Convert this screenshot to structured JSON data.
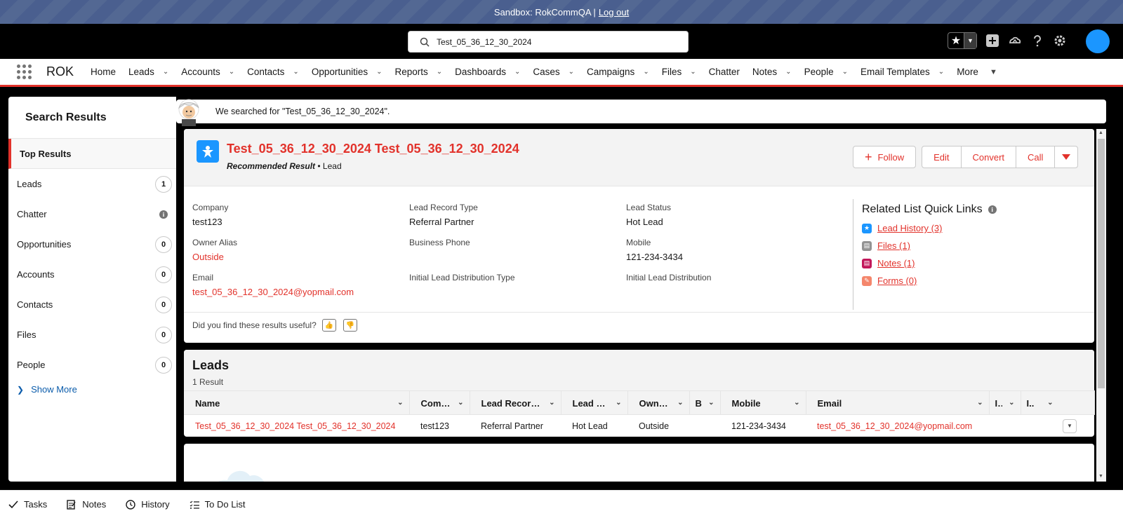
{
  "banner": {
    "text": "Sandbox: RokCommQA |",
    "logout": "Log out"
  },
  "search": {
    "value": "Test_05_36_12_30_2024"
  },
  "app": {
    "name": "ROK",
    "nav": [
      {
        "label": "Home",
        "chevron": false
      },
      {
        "label": "Leads",
        "chevron": true
      },
      {
        "label": "Accounts",
        "chevron": true
      },
      {
        "label": "Contacts",
        "chevron": true
      },
      {
        "label": "Opportunities",
        "chevron": true
      },
      {
        "label": "Reports",
        "chevron": true
      },
      {
        "label": "Dashboards",
        "chevron": true
      },
      {
        "label": "Cases",
        "chevron": true
      },
      {
        "label": "Campaigns",
        "chevron": true
      },
      {
        "label": "Files",
        "chevron": true
      },
      {
        "label": "Chatter",
        "chevron": false
      },
      {
        "label": "Notes",
        "chevron": true
      },
      {
        "label": "People",
        "chevron": true
      },
      {
        "label": "Email Templates",
        "chevron": true
      },
      {
        "label": "More",
        "chevron": true
      }
    ]
  },
  "sidebar": {
    "title": "Search Results",
    "top": "Top Results",
    "items": [
      {
        "label": "Leads",
        "count": "1"
      },
      {
        "label": "Chatter",
        "count": ""
      },
      {
        "label": "Opportunities",
        "count": "0"
      },
      {
        "label": "Accounts",
        "count": "0"
      },
      {
        "label": "Contacts",
        "count": "0"
      },
      {
        "label": "Files",
        "count": "0"
      },
      {
        "label": "People",
        "count": "0"
      }
    ],
    "show_more": "Show More"
  },
  "notice": "We searched for \"Test_05_36_12_30_2024\".",
  "recommended": {
    "title": "Test_05_36_12_30_2024 Test_05_36_12_30_2024",
    "badge": "Recommended Result",
    "separator": "•",
    "type": "Lead",
    "actions": {
      "follow": "Follow",
      "edit": "Edit",
      "convert": "Convert",
      "call": "Call"
    },
    "fields": [
      {
        "label": "Company",
        "value": "test123",
        "link": false
      },
      {
        "label": "Lead Record Type",
        "value": "Referral Partner",
        "link": false
      },
      {
        "label": "Lead Status",
        "value": "Hot Lead",
        "link": false
      },
      {
        "label": "Owner Alias",
        "value": "Outside",
        "link": true
      },
      {
        "label": "Business Phone",
        "value": "",
        "link": false
      },
      {
        "label": "Mobile",
        "value": "121-234-3434",
        "link": false
      },
      {
        "label": "Email",
        "value": "test_05_36_12_30_2024@yopmail.com",
        "link": true
      },
      {
        "label": "Initial Lead Distribution Type",
        "value": "",
        "link": false
      },
      {
        "label": "Initial Lead Distribution",
        "value": "",
        "link": false
      }
    ],
    "quick_links": {
      "title": "Related List Quick Links",
      "items": [
        {
          "label": "Lead History (3)",
          "color": "#1b96ff"
        },
        {
          "label": "Files (1)",
          "color": "#939393"
        },
        {
          "label": "Notes (1)",
          "color": "#c2185b"
        },
        {
          "label": "Forms (0)",
          "color": "#f4866c"
        }
      ]
    },
    "feedback": "Did you find these results useful?"
  },
  "leads": {
    "title": "Leads",
    "subtitle": "1 Result",
    "columns": [
      "Name",
      "Comp...",
      "Lead Record T...",
      "Lead St...",
      "Owner ...",
      "B.",
      "Mobile",
      "Email",
      "I..",
      "I.."
    ],
    "rows": [
      [
        "Test_05_36_12_30_2024 Test_05_36_12_30_2024",
        "test123",
        "Referral Partner",
        "Hot Lead",
        "Outside",
        "",
        "121-234-3434",
        "test_05_36_12_30_2024@yopmail.com",
        "",
        ""
      ]
    ]
  },
  "utility": [
    {
      "label": "Tasks",
      "icon": "check-icon"
    },
    {
      "label": "Notes",
      "icon": "note-icon"
    },
    {
      "label": "History",
      "icon": "clock-icon"
    },
    {
      "label": "To Do List",
      "icon": "list-icon"
    }
  ],
  "colors": {
    "brand": "#e2322b",
    "lead": "#1b96ff",
    "link": "#0b5cab"
  }
}
